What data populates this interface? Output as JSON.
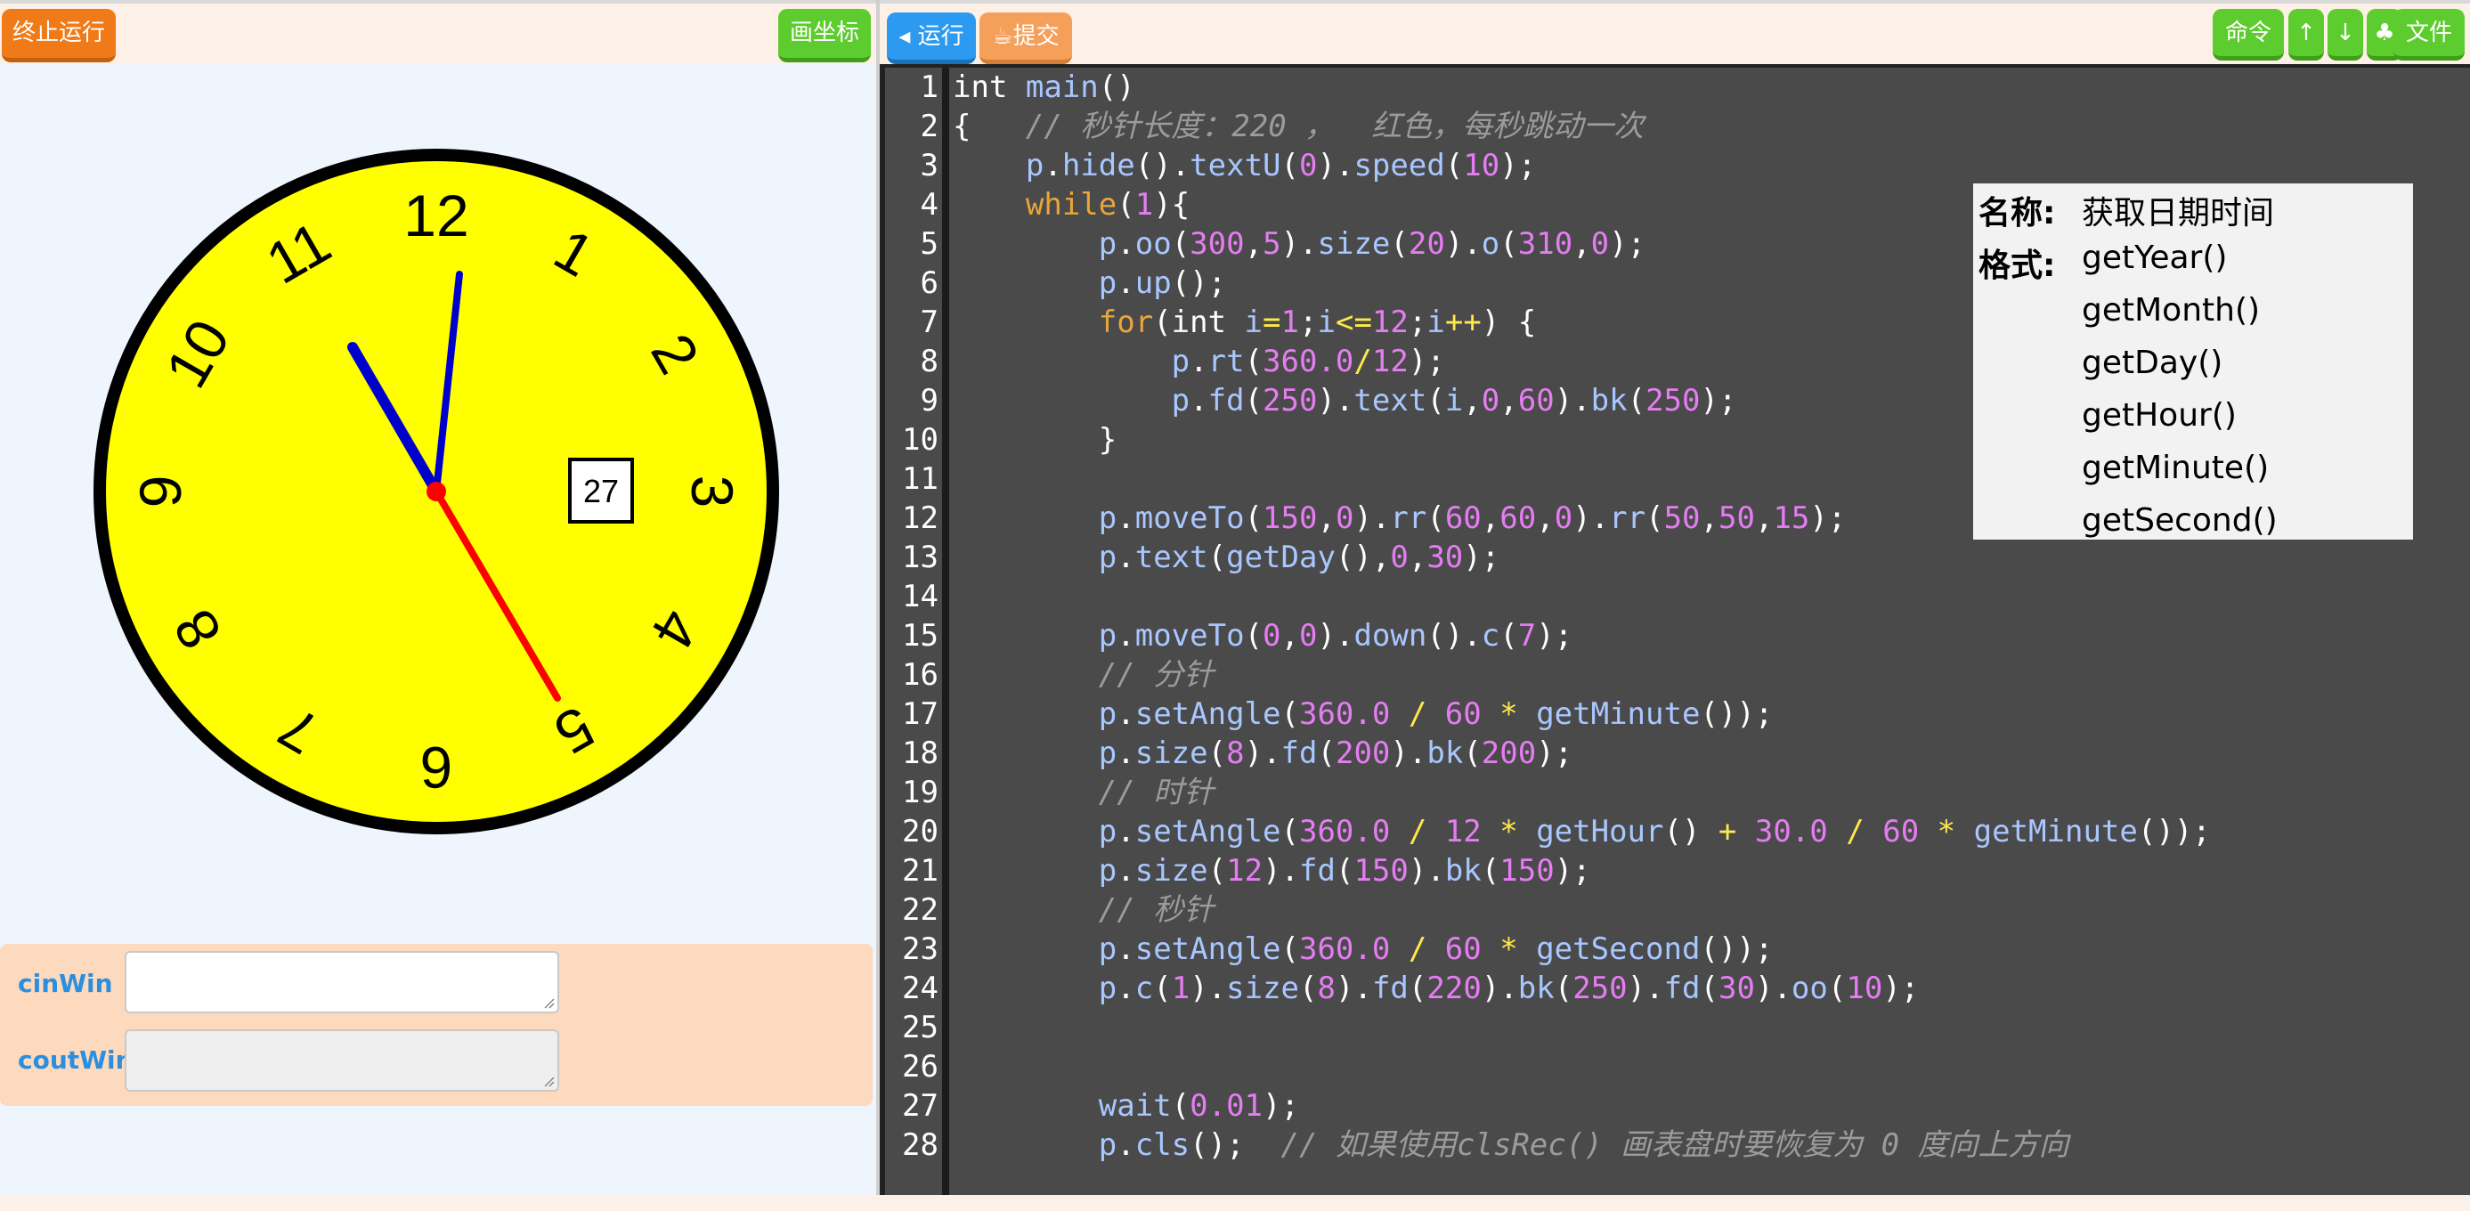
{
  "left_panel": {
    "stop_button": "终止运行",
    "coord_button": "画坐标",
    "clock": {
      "numbers": [
        "12",
        "1",
        "2",
        "3",
        "4",
        "5",
        "6",
        "7",
        "8",
        "9",
        "10",
        "11"
      ],
      "date_box": "27",
      "colors": {
        "face": "#ffff00",
        "rim": "#000000",
        "hour_minute_hands": "#0000cc",
        "second_hand": "#ff0000"
      }
    },
    "io": {
      "cin_label": "cinWin",
      "cout_label": "coutWin",
      "cin_value": "",
      "cout_value": ""
    }
  },
  "right_panel": {
    "run_button": "◂ 运行",
    "submit_button": "☕提交",
    "cmd_button": "命令",
    "up_button": "↑",
    "down_button": "↓",
    "club_button": "♣",
    "file_button": "文件",
    "line_numbers": [
      "1",
      "2",
      "3",
      "4",
      "5",
      "6",
      "7",
      "8",
      "9",
      "10",
      "11",
      "12",
      "13",
      "14",
      "15",
      "16",
      "17",
      "18",
      "19",
      "20",
      "21",
      "22",
      "23",
      "24",
      "25",
      "26",
      "27",
      "28"
    ],
    "code": {
      "l1": "int main()",
      "l2a": "{",
      "l2b": "// 秒针长度：220 ，  红色，每秒跳动一次",
      "l16": "// 分针",
      "l19": "// 时针",
      "l22": "// 秒针",
      "l28c": "// 如果使用clsRec() 画表盘时要恢复为 0 度向上方向"
    },
    "help": {
      "name_key": "名称:",
      "name_val": "获取日期时间",
      "format_key": "格式:",
      "formats": [
        "getYear()",
        "getMonth()",
        "getDay()",
        "getHour()",
        "getMinute()",
        "getSecond()"
      ]
    }
  }
}
